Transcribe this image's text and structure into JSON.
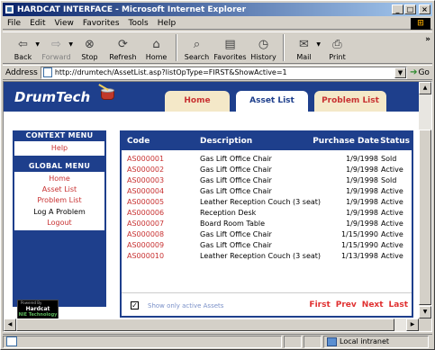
{
  "window": {
    "title": "HARDCAT INTERFACE - Microsoft Internet Explorer",
    "minimize": "_",
    "maximize": "□",
    "close": "×"
  },
  "menubar": {
    "items": [
      "File",
      "Edit",
      "View",
      "Favorites",
      "Tools",
      "Help"
    ]
  },
  "toolbar": {
    "back": "Back",
    "forward": "Forward",
    "stop": "Stop",
    "refresh": "Refresh",
    "home": "Home",
    "search": "Search",
    "favorites": "Favorites",
    "history": "History",
    "mail": "Mail",
    "print": "Print",
    "more": "»"
  },
  "address": {
    "label": "Address",
    "url": "http://drumtech/AssetList.asp?listOpType=FIRST&ShowActive=1",
    "go": "Go"
  },
  "site": {
    "brand": "DrumTech",
    "tabs": {
      "home": "Home",
      "asset_list": "Asset List",
      "problem_list": "Problem List"
    }
  },
  "side": {
    "context_title": "CONTEXT MENU",
    "context_items": [
      "Help"
    ],
    "global_title": "GLOBAL MENU",
    "global_links": [
      "Home",
      "Asset List",
      "Problem List"
    ],
    "log_problem": "Log A Problem",
    "logout": "Logout",
    "powered": {
      "line1": "Powered By",
      "line2": "Hardcat",
      "line3": "NIE Technology"
    }
  },
  "table": {
    "headers": {
      "code": "Code",
      "description": "Description",
      "purchase_date": "Purchase Date",
      "status": "Status"
    },
    "rows": [
      {
        "code": "AS000001",
        "description": "Gas Lift Office Chair",
        "date": "1/9/1998",
        "status": "Sold"
      },
      {
        "code": "AS000002",
        "description": "Gas Lift Office Chair",
        "date": "1/9/1998",
        "status": "Active"
      },
      {
        "code": "AS000003",
        "description": "Gas Lift Office Chair",
        "date": "1/9/1998",
        "status": "Sold"
      },
      {
        "code": "AS000004",
        "description": "Gas Lift Office Chair",
        "date": "1/9/1998",
        "status": "Active"
      },
      {
        "code": "AS000005",
        "description": "Leather Reception Couch (3 seat)",
        "date": "1/9/1998",
        "status": "Active"
      },
      {
        "code": "AS000006",
        "description": "Reception Desk",
        "date": "1/9/1998",
        "status": "Active"
      },
      {
        "code": "AS000007",
        "description": "Board Room Table",
        "date": "1/9/1998",
        "status": "Active"
      },
      {
        "code": "AS000008",
        "description": "Gas Lift Office Chair",
        "date": "1/15/1990",
        "status": "Active"
      },
      {
        "code": "AS000009",
        "description": "Gas Lift Office Chair",
        "date": "1/15/1990",
        "status": "Active"
      },
      {
        "code": "AS000010",
        "description": "Leather Reception Couch (3 seat)",
        "date": "1/13/1998",
        "status": "Active"
      }
    ],
    "show_active_label": "Show only active Assets",
    "show_active_checked": true,
    "pager": {
      "first": "First",
      "prev": "Prev",
      "next": "Next",
      "last": "Last"
    }
  },
  "statusbar": {
    "zone": "Local intranet"
  },
  "colors": {
    "title_gradient_start": "#0a246a",
    "site_navy": "#1e3f8c",
    "link_red": "#c83232",
    "tab_inactive": "#f4e8c8"
  }
}
